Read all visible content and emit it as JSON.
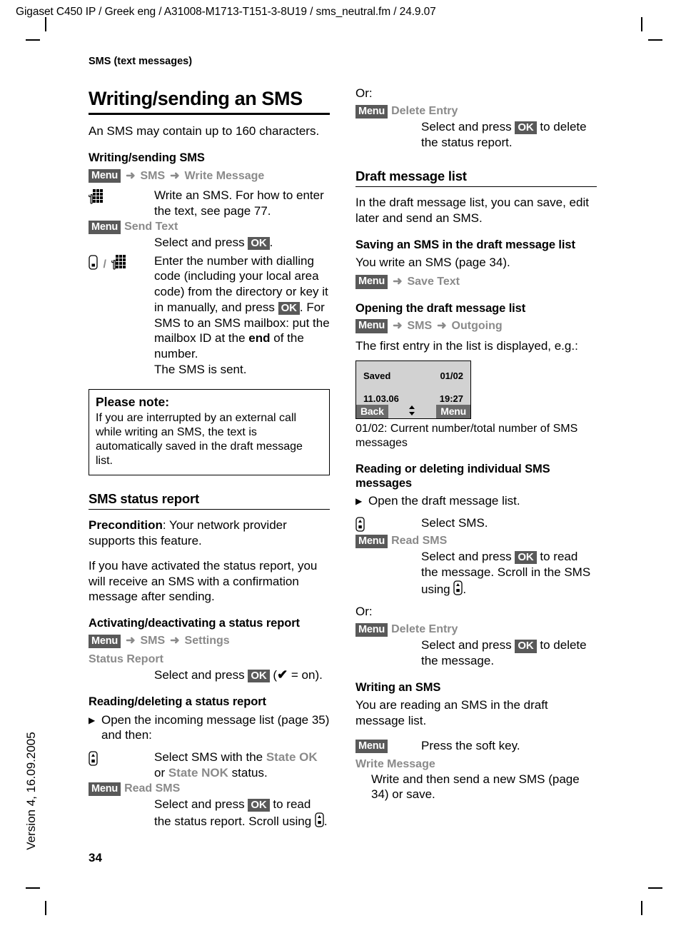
{
  "running_header": "Gigaset C450 IP / Greek eng / A31008-M1713-T151-3-8U19 / sms_neutral.fm / 24.9.07",
  "version_sidebar": "Version 4, 16.09.2005",
  "page_number": "34",
  "left_column": {
    "chapter_label": "SMS (text messages)",
    "title": "Writing/sending an SMS",
    "intro": "An SMS may contain up to 160 characters.",
    "sub1_heading": "Writing/sending SMS",
    "path1": {
      "softkey": "Menu",
      "arrow": "➜",
      "item1": "SMS",
      "item2": "Write Message"
    },
    "step1_desc": "Write an SMS. For how to enter the text, see page 77.",
    "step2_label": "Send Text",
    "step2_softkey": "Menu",
    "step2_desc_a": "Select and press ",
    "step2_ok": "OK",
    "step2_desc_b": ".",
    "step3_desc_1": "Enter the number with dialling code (including your local area code) from the directory or key it in manually, and press ",
    "step3_ok": "OK",
    "step3_desc_2": ". For SMS to an SMS mailbox: put the mailbox ID at the ",
    "step3_bold": "end",
    "step3_desc_3": " of the number.",
    "step3_desc_4": "The SMS is sent.",
    "note_title": "Please note:",
    "note_body": "If you are interrupted by an external call while writing an SMS, the text is automatically saved in the draft message list.",
    "sec2_heading": "SMS status report",
    "precondition_bold": "Precondition",
    "precondition_rest": ": Your network provider supports this feature.",
    "status_para": "If you have activated the status report, you will receive an SMS with a confirmation message after sending.",
    "sub2_heading": "Activating/deactivating a status report",
    "path2": {
      "softkey": "Menu",
      "arrow": "➜",
      "item1": "SMS",
      "item2": "Settings"
    },
    "status_report_label": "Status Report",
    "status_select_a": "Select and press ",
    "status_ok": "OK",
    "status_select_b": " (",
    "status_check": "✔",
    "status_select_c": " = on).",
    "sub3_heading": "Reading/deleting a status report",
    "bullet1": "Open the incoming message list (page 35) and then:",
    "select_sms_a": "Select SMS with the ",
    "state_ok": "State OK",
    "select_sms_b": " or ",
    "state_nok": "State NOK",
    "select_sms_c": " status.",
    "read_sms_softkey": "Menu",
    "read_sms_label": "Read SMS",
    "read_desc_a": "Select and press ",
    "read_ok": "OK",
    "read_desc_b": " to read the status report. Scroll using ",
    "read_desc_c": "."
  },
  "right_column": {
    "or_1": "Or:",
    "delete_entry_softkey": "Menu",
    "delete_entry_label": "Delete Entry",
    "delete_desc_a": "Select and press ",
    "delete_ok": "OK",
    "delete_desc_b": " to delete the status report.",
    "sec_heading": "Draft message list",
    "draft_intro": "In the draft message list, you can save, edit later and send an SMS.",
    "sub1_heading": "Saving an SMS in the draft message list",
    "write_sms_para": "You write an SMS (page 34).",
    "path1": {
      "softkey": "Menu",
      "arrow": "➜",
      "item1": "Save Text"
    },
    "sub2_heading": "Opening the draft message list",
    "path2": {
      "softkey": "Menu",
      "arrow": "➜",
      "item1": "SMS",
      "item2": "Outgoing"
    },
    "first_entry_para": "The first entry in the list is displayed, e.g.:",
    "display": {
      "status": "Saved",
      "counter": "01/02",
      "date": "11.03.06",
      "time": "19:27",
      "softkey_left": "Back",
      "softkey_right": "Menu",
      "scroll_glyph": "⬍"
    },
    "display_caption": "01/02: Current number/total number of SMS messages",
    "sub3_heading": "Reading or deleting individual SMS messages",
    "bullet1": "Open the draft message list.",
    "select_sms": "Select SMS.",
    "read_sms_softkey": "Menu",
    "read_sms_label": "Read SMS",
    "read_desc_a": "Select and press ",
    "read_ok": "OK",
    "read_desc_b": " to read the message. Scroll in the SMS using ",
    "read_desc_c": ".",
    "or_2": "Or:",
    "delete2_softkey": "Menu",
    "delete2_label": "Delete Entry",
    "delete2_desc_a": "Select and press ",
    "delete2_ok": "OK",
    "delete2_desc_b": " to delete the message.",
    "sub4_heading": "Writing an SMS",
    "reading_para": "You are reading an SMS in the draft message list.",
    "press_softkey": "Menu",
    "press_desc": "Press the soft key.",
    "write_message_label": "Write Message",
    "write_message_desc": "Write and then send a new SMS (page 34) or save."
  },
  "colors": {
    "softkey_bg": "#595959",
    "grey_text": "#8a8a8a",
    "display_bg": "#d2d2d2",
    "display_softkey_bg": "#6b6b6b"
  }
}
